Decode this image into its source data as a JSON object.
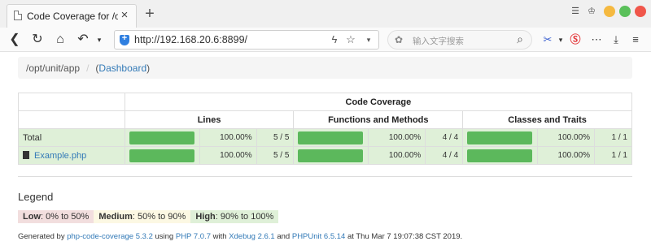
{
  "browser": {
    "tab_title": "Code Coverage for /opt",
    "url": "http://192.168.20.6:8899/",
    "search_placeholder": "输入文字搜索",
    "new_tab": "+",
    "tab_close": "×"
  },
  "breadcrumb": {
    "path": "/opt/unit/app",
    "separator": "/",
    "open_paren": "(",
    "dashboard": "Dashboard",
    "close_paren": ")"
  },
  "table": {
    "group_header": "Code Coverage",
    "headers": {
      "lines": "Lines",
      "functions": "Functions and Methods",
      "classes": "Classes and Traits"
    },
    "rows": [
      {
        "name": "Total",
        "lines_pct": "100.00%",
        "lines_ratio": "5 / 5",
        "lines_fill": 1.0,
        "func_pct": "100.00%",
        "func_ratio": "4 / 4",
        "func_fill": 1.0,
        "class_pct": "100.00%",
        "class_ratio": "1 / 1",
        "class_fill": 1.0
      },
      {
        "name": "Example.php",
        "lines_pct": "100.00%",
        "lines_ratio": "5 / 5",
        "lines_fill": 1.0,
        "func_pct": "100.00%",
        "func_ratio": "4 / 4",
        "func_fill": 1.0,
        "class_pct": "100.00%",
        "class_ratio": "1 / 1",
        "class_fill": 1.0
      }
    ]
  },
  "legend": {
    "title": "Legend",
    "low_label": "Low",
    "low_range": ": 0% to 50%",
    "medium_label": "Medium",
    "medium_range": ": 50% to 90%",
    "high_label": "High",
    "high_range": ": 90% to 100%"
  },
  "footer": {
    "t1": "Generated by ",
    "l1": "php-code-coverage 5.3.2",
    "t2": " using ",
    "l2": "PHP 7.0.7",
    "t3": " with ",
    "l3": "Xdebug 2.6.1",
    "t4": " and ",
    "l4": "PHPUnit 6.5.14",
    "t5": " at Thu Mar 7 19:07:38 CST 2019."
  },
  "colors": {
    "low": "#f2dede",
    "medium": "#fcf8e3",
    "high": "#dff0d8",
    "bar": "#5cb85c",
    "link": "#337ab7"
  }
}
